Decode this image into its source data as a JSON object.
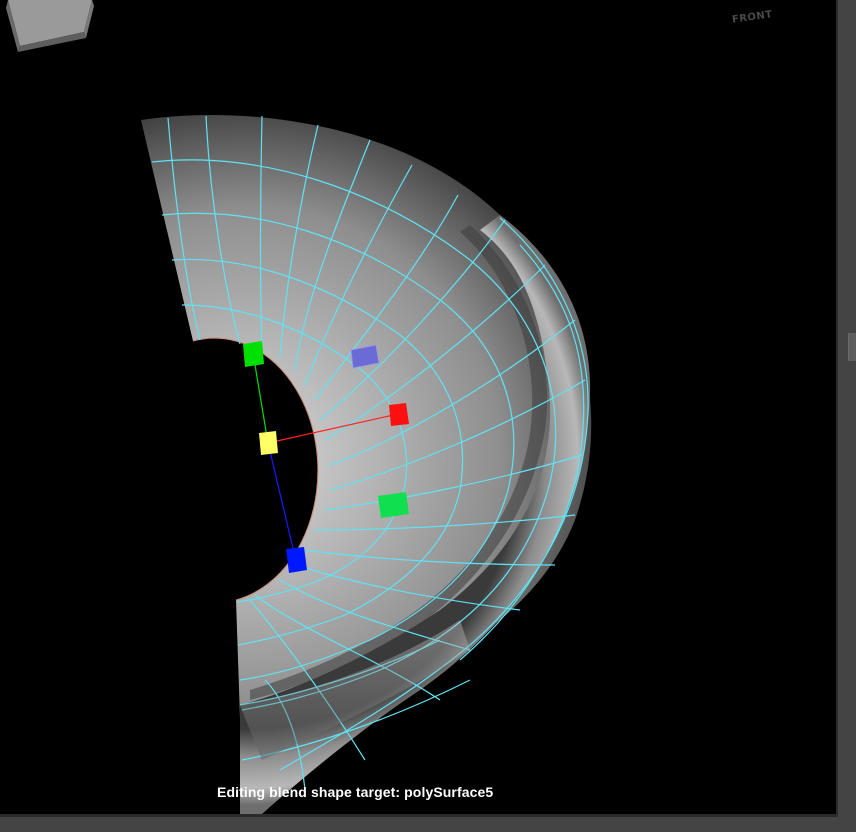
{
  "viewport": {
    "status_message": "Editing blend shape target: polySurface5",
    "view_cube_label": "FRONT"
  },
  "colors": {
    "background": "#000000",
    "mesh_fill": "#8a8a8a",
    "wireframe": "#5fe3f4",
    "manipulator_x": "#ff0000",
    "manipulator_y": "#00e000",
    "manipulator_z": "#0000ff",
    "manipulator_center": "#ffff66",
    "manipulator_xz_plane": "#00e040",
    "manipulator_xy_plane": "#6b6bd6",
    "frame": "#444444"
  },
  "icons": {
    "view_cube": "view-cube-icon",
    "move_tool": "move-manipulator-icon"
  }
}
